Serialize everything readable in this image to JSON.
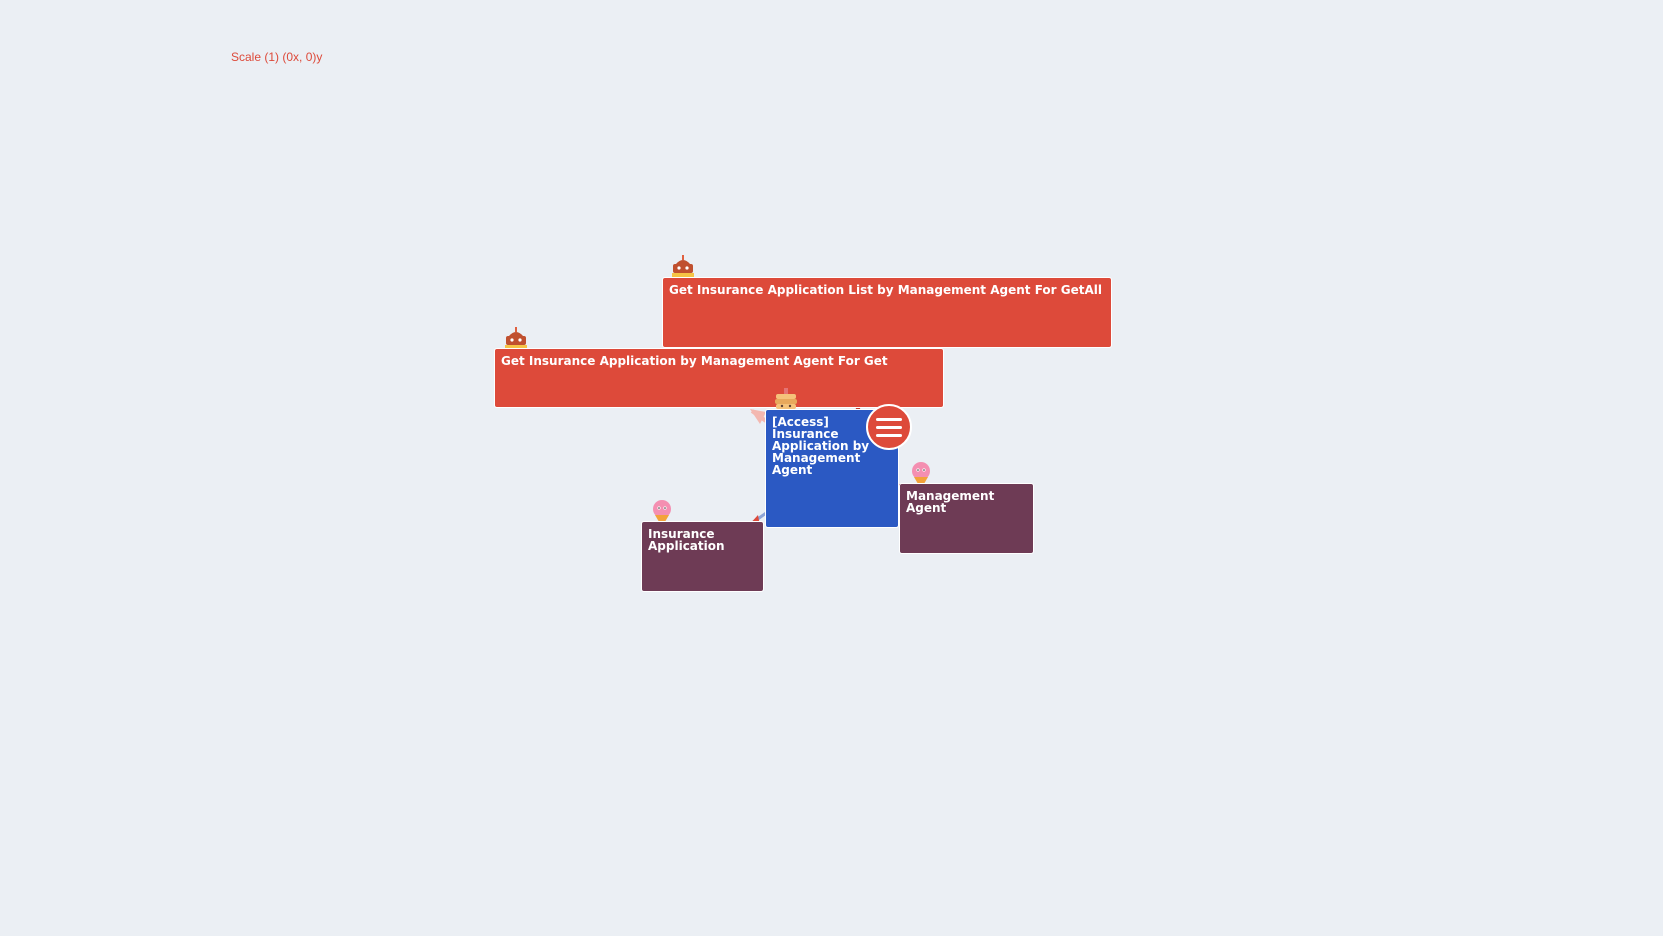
{
  "canvas": {
    "background": "#ebeff4",
    "scale_readout": "Scale (1) (0x, 0)y"
  },
  "colors": {
    "query": "#dd4a3a",
    "access": "#2b59c3",
    "entity": "#6e3b55"
  },
  "nodes": {
    "getall": {
      "label": "Get Insurance Application List by Management Agent For GetAll",
      "kind": "query",
      "mascot": "cake-icon"
    },
    "get": {
      "label": "Get Insurance Application by Management Agent For Get",
      "kind": "query",
      "mascot": "cake-icon"
    },
    "access": {
      "label": "[Access] Insurance Application by Management Agent",
      "kind": "access",
      "mascot": "pancake-icon"
    },
    "insurance_application": {
      "label": "Insurance Application",
      "kind": "entity",
      "mascot": "ice-cream-icon"
    },
    "management_agent": {
      "label": "Management Agent",
      "kind": "entity",
      "mascot": "ice-cream-icon"
    }
  },
  "links": [
    {
      "from": "getall",
      "to": "access"
    },
    {
      "from": "get",
      "to": "access"
    },
    {
      "from": "access",
      "to": "insurance_application"
    },
    {
      "from": "access",
      "to": "management_agent"
    }
  ],
  "menu": {
    "icon": "hamburger-menu-icon"
  }
}
